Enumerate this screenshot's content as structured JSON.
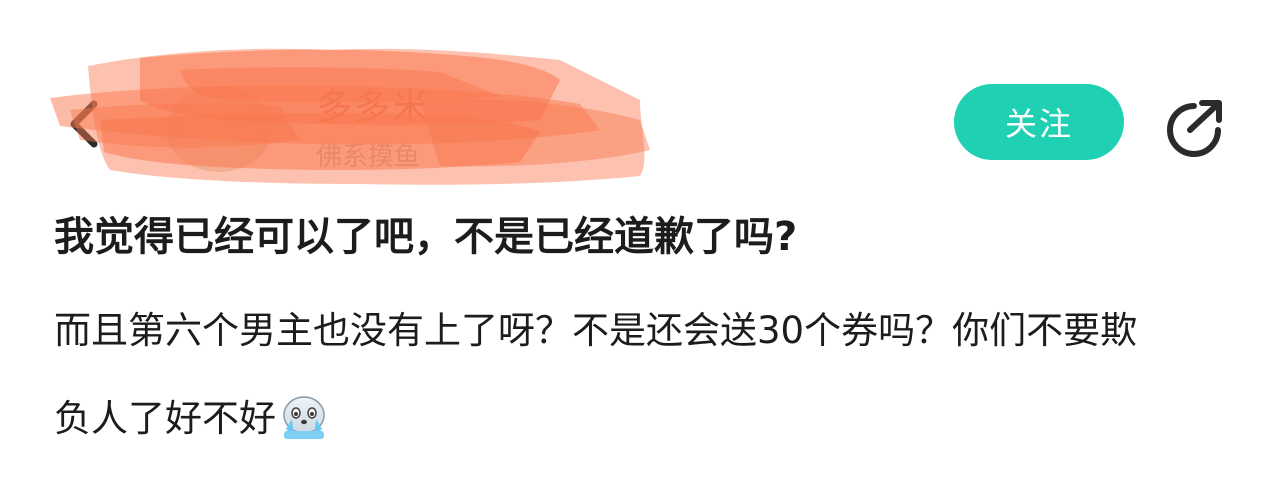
{
  "header": {
    "username": "多多米",
    "user_subtitle": "佛系摸鱼",
    "follow_label": "关注",
    "colors": {
      "accent": "#1fd1b2",
      "scribble": "#f9784e"
    }
  },
  "post": {
    "title": "我觉得已经可以了吧，不是已经道歉了吗?",
    "body": "而且第六个男主也没有上了呀？不是还会送30个券吗？你们不要欺负人了好不好",
    "emoji_name": "crying-seal-emoji"
  },
  "icons": {
    "back": "chevron-left-icon",
    "share": "share-arrow-icon"
  }
}
